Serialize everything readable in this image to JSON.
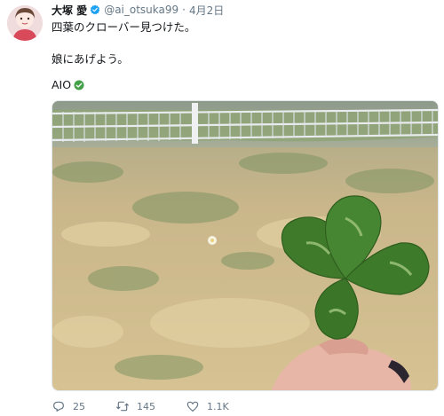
{
  "tweet": {
    "author_name": "大塚 愛",
    "handle": "@ai_otsuka99",
    "separator": "·",
    "date": "4月2日",
    "lines": [
      "四葉のクローバー見つけた。",
      "娘にあげよう。",
      "AIO"
    ],
    "avatar_icon": "avatar-icon",
    "verified_icon": "verified-badge-icon",
    "aio_check_icon": "check-mark-icon",
    "image_icon": "clover-photo",
    "actions": {
      "reply_icon": "reply-icon",
      "reply_count": "25",
      "retweet_icon": "retweet-icon",
      "retweet_count": "145",
      "like_icon": "heart-icon",
      "like_count": "1.1K"
    },
    "colors": {
      "verified": "#1da1f2",
      "check_green": "#43a047",
      "muted_text": "#657786"
    }
  }
}
